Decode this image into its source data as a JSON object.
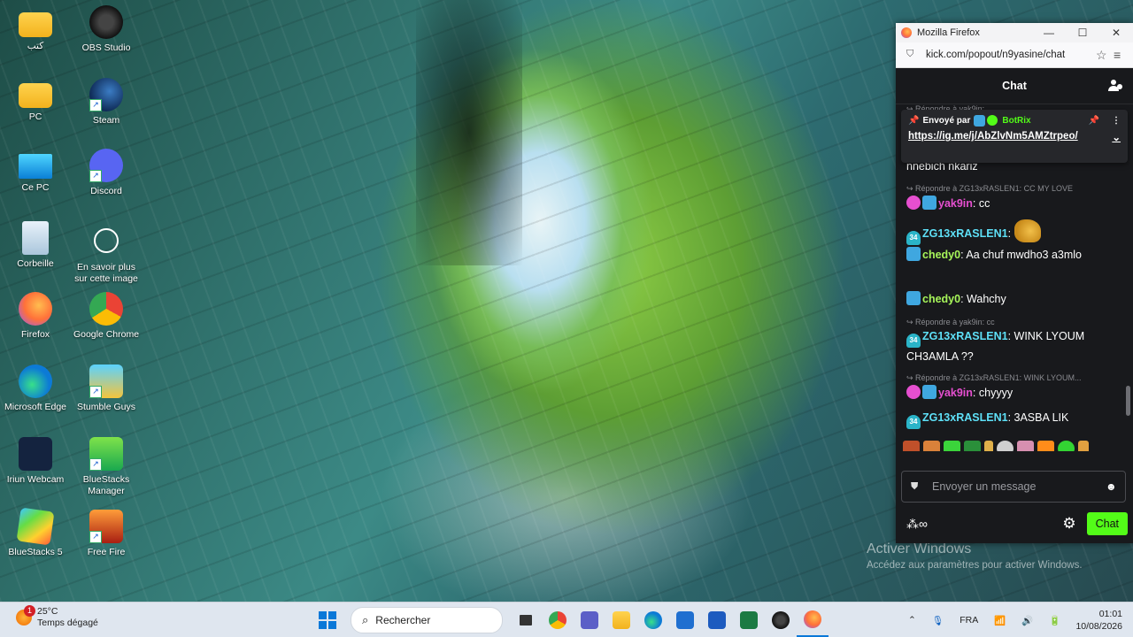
{
  "desktop": {
    "icons": [
      {
        "label": "كتب",
        "icon": "folder-icon"
      },
      {
        "label": "OBS Studio",
        "icon": "obs-icon"
      },
      {
        "label": "PC",
        "icon": "folder-icon"
      },
      {
        "label": "Steam",
        "icon": "steam-icon"
      },
      {
        "label": "Ce PC",
        "icon": "monitor-icon"
      },
      {
        "label": "Discord",
        "icon": "discord-icon"
      },
      {
        "label": "Corbeille",
        "icon": "recycle-bin-icon"
      },
      {
        "label": "En savoir plus sur cette image",
        "icon": "info-camera-icon"
      },
      {
        "label": "Firefox",
        "icon": "firefox-icon"
      },
      {
        "label": "Google Chrome",
        "icon": "chrome-icon"
      },
      {
        "label": "Microsoft Edge",
        "icon": "edge-icon"
      },
      {
        "label": "Stumble Guys",
        "icon": "stumble-guys-icon"
      },
      {
        "label": "Iriun Webcam",
        "icon": "webcam-icon"
      },
      {
        "label": "BlueStacks Manager",
        "icon": "bluestacks-manager-icon"
      },
      {
        "label": "BlueStacks 5",
        "icon": "bluestacks-icon"
      },
      {
        "label": "Free Fire",
        "icon": "free-fire-icon"
      }
    ],
    "watermark": {
      "title": "Activer Windows",
      "subtitle": "Accédez aux paramètres pour activer Windows."
    }
  },
  "firefox": {
    "window_title": "Mozilla Firefox",
    "url": "kick.com/popout/n9yasine/chat",
    "chat": {
      "header": "Chat",
      "pinned": {
        "sent_by": "Envoyé par",
        "bot_name": "BotRix",
        "link": "https://ig.me/j/AbZlvNm5AMZtrpeo/"
      },
      "messages": [
        {
          "type": "reply",
          "text": "↪ Répondre à yak9in:"
        },
        {
          "type": "text",
          "text": "nnebich nkariz"
        },
        {
          "type": "reply",
          "text": "↪ Répondre à ZG13xRASLEN1: CC MY LOVE"
        },
        {
          "user": "yak9in",
          "text": " cc"
        },
        {
          "user": "ZG13xRASLEN1",
          "text": " "
        },
        {
          "user": "chedy0",
          "text": " Aa chuf mwdho3 a3mlo"
        },
        {
          "user": "chedy0",
          "text": " Wahchy"
        },
        {
          "type": "reply",
          "text": "↪ Répondre à yak9in: cc"
        },
        {
          "user": "ZG13xRASLEN1",
          "text": " WINK LYOUM CH3AMLA ??"
        },
        {
          "type": "reply",
          "text": "↪ Répondre à ZG13xRASLEN1: WINK LYOUM..."
        },
        {
          "user": "yak9in",
          "text": " chyyyy"
        },
        {
          "user": "ZG13xRASLEN1",
          "text": " 3ASBA LIK"
        }
      ],
      "input_placeholder": "Envoyer un message",
      "send_label": "Chat",
      "sub_badge": "34"
    }
  },
  "taskbar": {
    "temperature": "25°C",
    "weather": "Temps dégagé",
    "notification_count": "1",
    "search_label": "Rechercher",
    "language": "FRA",
    "time": "01:01",
    "date": "10/08/2026"
  },
  "colors": {
    "kick_green": "#53fc18",
    "chat_bg": "#18191c",
    "taskbar_bg": "#dfe6ef"
  }
}
